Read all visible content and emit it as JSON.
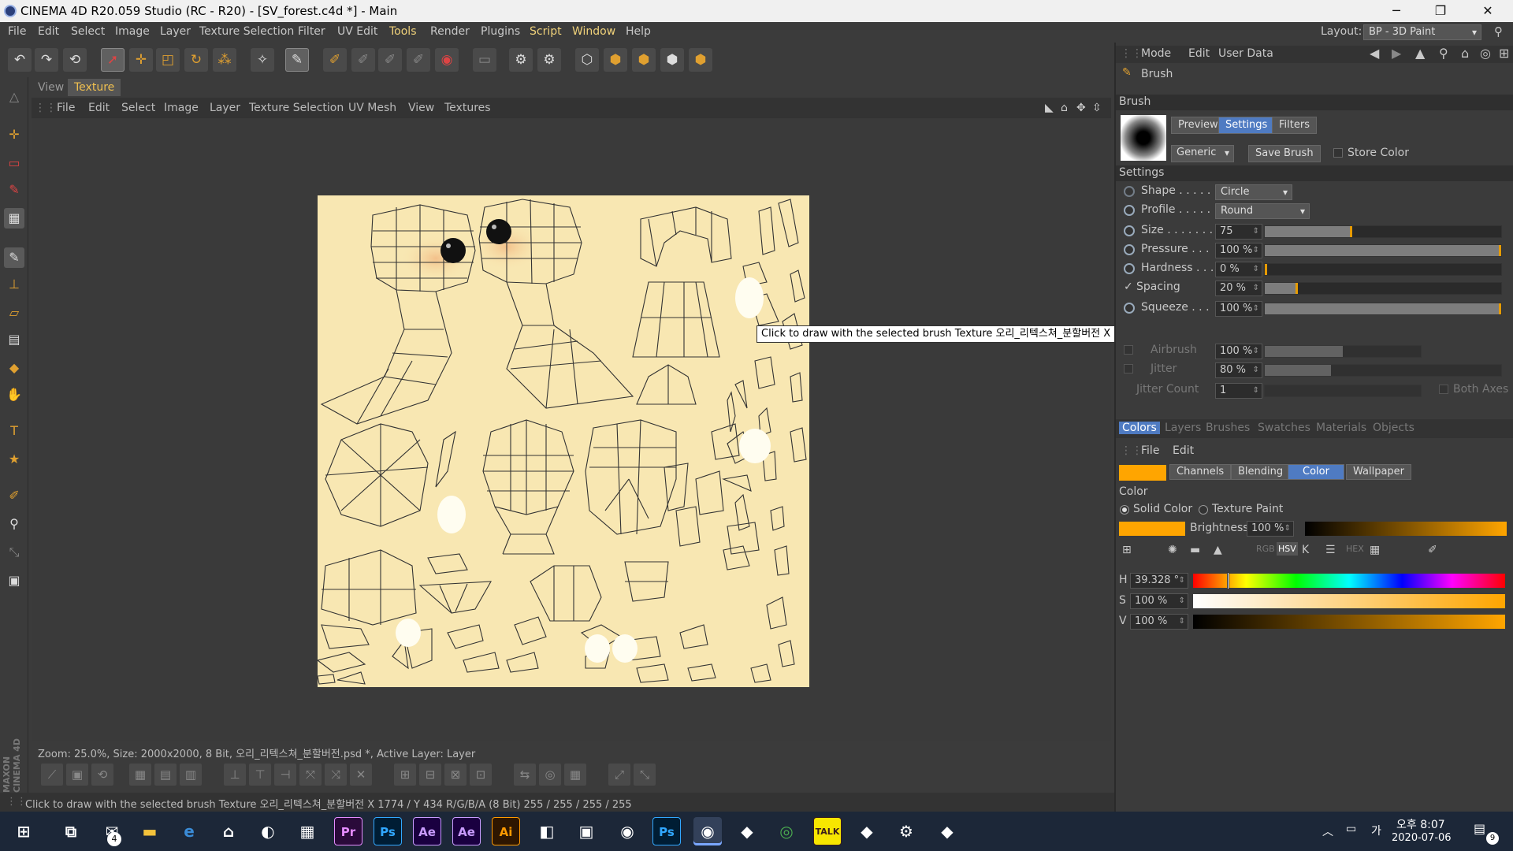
{
  "window": {
    "title": "CINEMA 4D R20.059 Studio (RC - R20) - [SV_forest.c4d *] - Main",
    "minimize": "─",
    "restore": "❐",
    "close": "✕"
  },
  "menu": [
    "File",
    "Edit",
    "Select",
    "Image",
    "Layer",
    "Texture Selection",
    "Filter",
    "UV Edit",
    "Tools",
    "Render",
    "Plugins",
    "Script",
    "Window",
    "Help"
  ],
  "layout": {
    "label": "Layout:",
    "value": "BP - 3D Paint"
  },
  "viewer_tabs": [
    "View",
    "Texture"
  ],
  "texture_menu": [
    "File",
    "Edit",
    "Select",
    "Image",
    "Layer",
    "Texture Selection",
    "UV Mesh",
    "View",
    "Textures"
  ],
  "tooltip": "Click to draw with the selected brush  Texture 오리_리텍스쳐_분할버전    X 1774 / Y 434 R/G/B/A (8 Bit) 255 / 255 / 255 / 255",
  "zoom_status": "Zoom: 25.0%, Size: 2000x2000, 8 Bit, 오리_리텍스쳐_분할버전.psd *, Active Layer: Layer",
  "status": "Click to draw with the selected brush  Texture 오리_리텍스쳐_분할버전    X 1774 / Y 434 R/G/B/A (8 Bit) 255 / 255 / 255 / 255",
  "attr_menu": [
    "Mode",
    "Edit",
    "User Data"
  ],
  "brush": {
    "title": "Brush",
    "section": "Brush",
    "tabs": [
      "Preview",
      "Settings",
      "Filters"
    ],
    "preset": "Generic",
    "save": "Save Brush",
    "store_color": "Store Color",
    "settings_title": "Settings",
    "shape_label": "Shape . . . . .",
    "shape": "Circle",
    "profile_label": "Profile . . . . .",
    "profile": "Round",
    "size_label": "Size . . . . . . .",
    "size": "75",
    "pressure_label": "Pressure . . .",
    "pressure": "100 %",
    "hardness_label": "Hardness . . .",
    "hardness": "0 %",
    "spacing_label": "Spacing",
    "spacing": "20 %",
    "squeeze_label": "Squeeze . . .",
    "squeeze": "100 %",
    "airbrush_label": "Airbrush",
    "airbrush": "100 %",
    "jitter_label": "Jitter",
    "jitter": "80 %",
    "jitter_count_label": "Jitter Count",
    "jitter_count": "1",
    "both_axes": "Both Axes"
  },
  "sliders": {
    "size": 0.37,
    "pressure": 1.0,
    "hardness": 0.0,
    "spacing": 0.14,
    "squeeze": 1.0,
    "airbrush": 0.5,
    "jitter": 0.28
  },
  "bottom_tabs": [
    "Colors",
    "Layers",
    "Brushes",
    "Swatches",
    "Materials",
    "Objects"
  ],
  "colors_menu": [
    "File",
    "Edit"
  ],
  "color_tabs": [
    "Channels",
    "Blending",
    "Color",
    "Wallpaper"
  ],
  "color": {
    "title": "Color",
    "solid": "Solid Color",
    "texture": "Texture Paint",
    "brightness_label": "Brightness",
    "brightness": "100 %",
    "h_label": "H",
    "h": "39.328 °",
    "s_label": "S",
    "s": "100 %",
    "v_label": "V",
    "v": "100 %",
    "swatch": "#ffa500",
    "hue_pos": 0.109
  },
  "maxon": "MAXON CINEMA 4D",
  "taskbar": {
    "apps": [
      "windows-icon",
      "task-view-icon",
      "mail-icon",
      "explorer-icon",
      "edge-icon",
      "store-icon",
      "photos-icon",
      "apps-icon",
      "Pr",
      "Ps",
      "Ae",
      "Ae",
      "Ai",
      "vs-icon",
      "notes-icon",
      "c4d-icon",
      "Ps",
      "c4d-icon",
      "app-icon",
      "chrome-icon",
      "TALK",
      "app-icon",
      "settings-icon",
      "app-icon"
    ],
    "mail_badge": "4",
    "ime": "가",
    "time": "오후 8:07",
    "date": "2020-07-06",
    "notify": "9"
  }
}
